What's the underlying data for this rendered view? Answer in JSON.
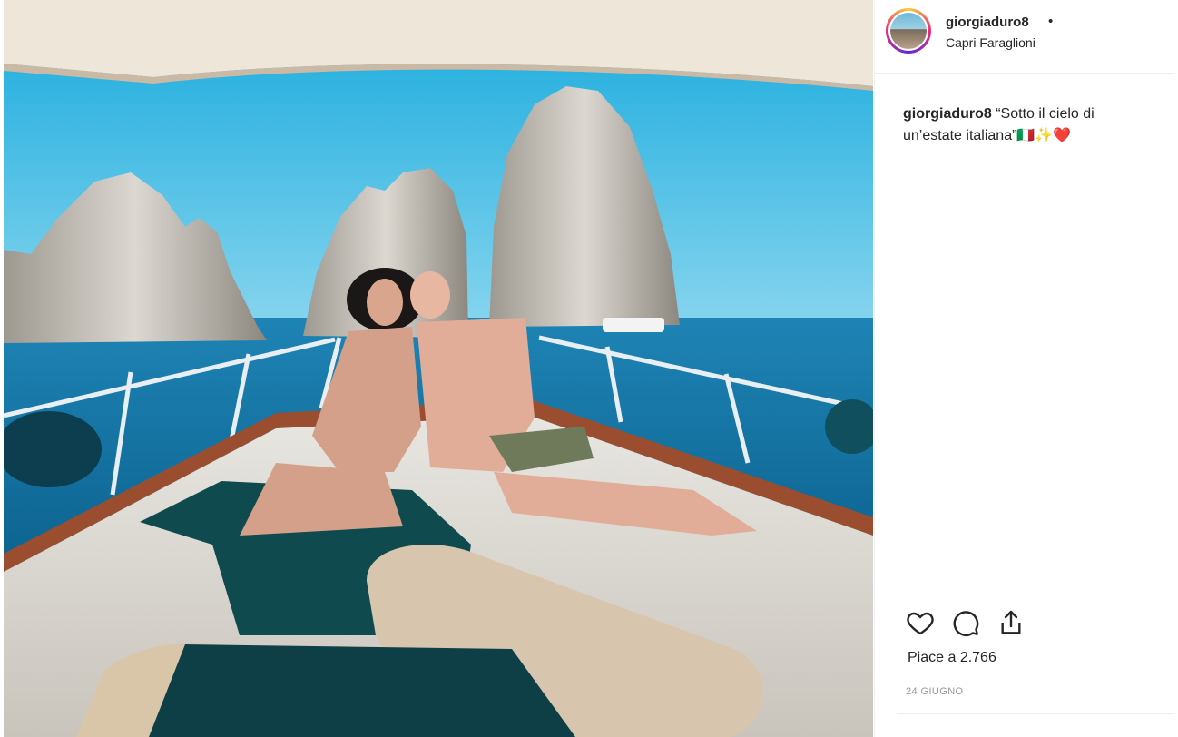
{
  "post": {
    "username": "giorgiaduro8",
    "dot": "•",
    "location": "Capri Faraglioni",
    "caption_username": "giorgiaduro8",
    "caption_text": " “Sotto il cielo di un’estate italiana”🇮🇹✨❤️",
    "likes": "Piace a 2.766",
    "date": "24 GIUGNO"
  },
  "icons": {
    "like": "heart-icon",
    "comment": "comment-icon",
    "share": "share-icon"
  },
  "colors": {
    "sky": "#1fb1df",
    "sea": "#0f6fa0",
    "deck": "#e7e3dc",
    "canopy": "#efe6da",
    "text": "#262626",
    "muted": "#999999"
  }
}
